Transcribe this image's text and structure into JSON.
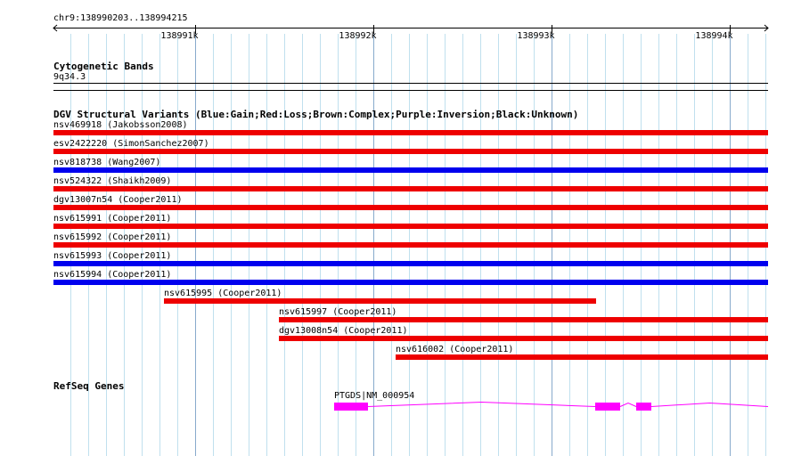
{
  "ruler": {
    "location": "chr9:138990203..138994215",
    "ticks": [
      {
        "pos": 138991000,
        "label": "138991k"
      },
      {
        "pos": 138992000,
        "label": "138992k"
      },
      {
        "pos": 138993000,
        "label": "138993k"
      },
      {
        "pos": 138994000,
        "label": "138994k"
      }
    ],
    "view_start": 138990203,
    "view_end": 138994215
  },
  "tracks": {
    "cytoband": {
      "title": "Cytogenetic Bands",
      "band": "9q34.3"
    },
    "dgv": {
      "title": "DGV Structural Variants (Blue:Gain;Red:Loss;Brown:Complex;Purple:Inversion;Black:Unknown)",
      "legend_colors": {
        "Gain": "#0000ee",
        "Loss": "#ee0000",
        "Complex": "#8b4513",
        "Inversion": "#800080",
        "Unknown": "#000000"
      },
      "features": [
        {
          "label": "nsv469918 (Jakobsson2008)",
          "type": "Loss",
          "start": 138990203,
          "end": 138994215
        },
        {
          "label": "esv2422220 (SimonSanchez2007)",
          "type": "Loss",
          "start": 138990203,
          "end": 138994215
        },
        {
          "label": "nsv818738 (Wang2007)",
          "type": "Gain",
          "start": 138990203,
          "end": 138994215
        },
        {
          "label": "nsv524322 (Shaikh2009)",
          "type": "Loss",
          "start": 138990203,
          "end": 138994215
        },
        {
          "label": "dgv13007n54 (Cooper2011)",
          "type": "Loss",
          "start": 138990203,
          "end": 138994215
        },
        {
          "label": "nsv615991 (Cooper2011)",
          "type": "Loss",
          "start": 138990203,
          "end": 138994215
        },
        {
          "label": "nsv615992 (Cooper2011)",
          "type": "Loss",
          "start": 138990203,
          "end": 138994215
        },
        {
          "label": "nsv615993 (Cooper2011)",
          "type": "Gain",
          "start": 138990203,
          "end": 138994215
        },
        {
          "label": "nsv615994 (Cooper2011)",
          "type": "Gain",
          "start": 138990203,
          "end": 138994215
        },
        {
          "label": "nsv615995 (Cooper2011)",
          "type": "Loss",
          "start": 138990825,
          "end": 138993252
        },
        {
          "label": "nsv615997 (Cooper2011)",
          "type": "Loss",
          "start": 138991470,
          "end": 138994215
        },
        {
          "label": "dgv13008n54 (Cooper2011)",
          "type": "Loss",
          "start": 138991470,
          "end": 138994215
        },
        {
          "label": "nsv616002 (Cooper2011)",
          "type": "Loss",
          "start": 138992122,
          "end": 138994215
        }
      ]
    },
    "refseq": {
      "title": "RefSeq Genes",
      "genes": [
        {
          "label": "PTGDS|NM_000954",
          "start": 138991780,
          "end": 138994215,
          "exons": [
            [
              138991780,
              138991970
            ],
            [
              138993244,
              138993387
            ],
            [
              138993475,
              138993560
            ]
          ],
          "color": "#ff00ff"
        }
      ]
    }
  }
}
